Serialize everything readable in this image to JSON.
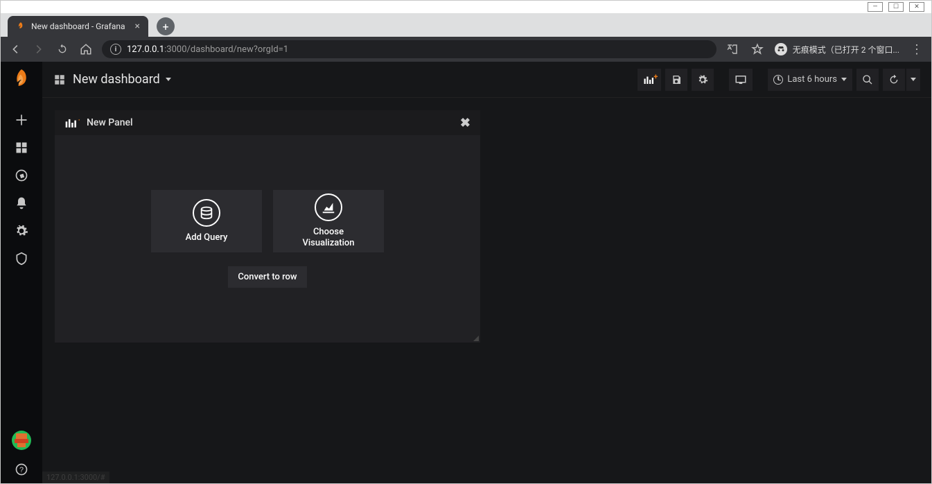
{
  "window": {
    "min": "—",
    "max": "☐",
    "close": "✕"
  },
  "browser": {
    "tab_title": "New dashboard - Grafana",
    "url_host": "127.0.0.1",
    "url_port_path": ":3000/dashboard/new?orgId=1",
    "incognito_text": "无痕模式（已打开 2 个窗口...",
    "new_tab": "+",
    "info": "i"
  },
  "topbar": {
    "title": "New dashboard",
    "time_label": "Last 6 hours"
  },
  "panel": {
    "title": "New Panel",
    "add_query": "Add Query",
    "choose_viz": "Choose\nVisualization",
    "convert": "Convert to row"
  },
  "footer_url": "127.0.0.1:3000/#"
}
